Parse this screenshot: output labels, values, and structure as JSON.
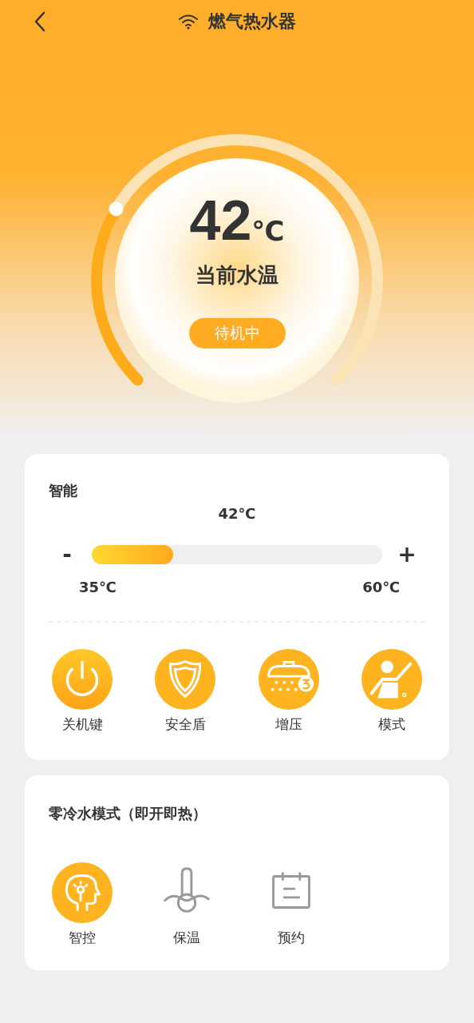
{
  "header": {
    "title": "燃气热水器"
  },
  "gauge": {
    "temperature": "42",
    "unit": "℃",
    "label": "当前水温",
    "status": "待机中"
  },
  "smart": {
    "title": "智能",
    "setpoint": "42℃",
    "decrease": "-",
    "increase": "+",
    "min": "35℃",
    "max": "60℃",
    "level": 0.28
  },
  "functions": [
    {
      "label": "关机键",
      "kind": "power"
    },
    {
      "label": "安全盾",
      "kind": "shield"
    },
    {
      "label": "增压",
      "kind": "shower"
    },
    {
      "label": "模式",
      "kind": "person"
    }
  ],
  "zero_cold": {
    "title": "零冷水模式（即开即热）",
    "modes": [
      {
        "label": "智控",
        "kind": "brain",
        "selected": true
      },
      {
        "label": "保温",
        "kind": "thermo",
        "selected": false
      },
      {
        "label": "预约",
        "kind": "calendar",
        "selected": false
      }
    ]
  }
}
